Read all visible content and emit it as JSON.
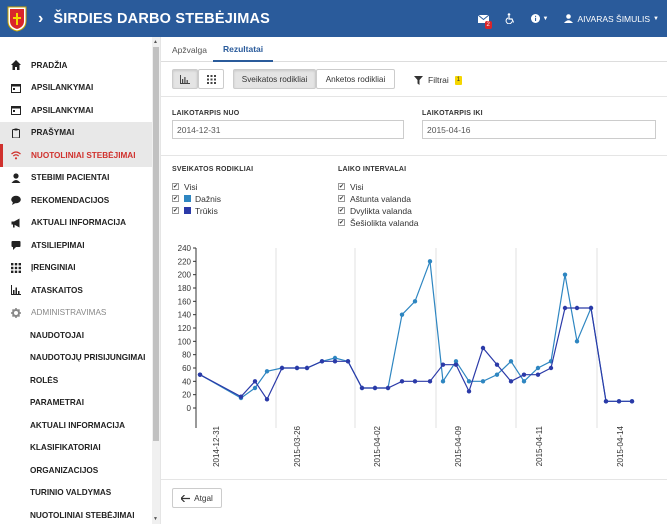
{
  "header": {
    "title": "ŠIRDIES DARBO STEBĖJIMAS",
    "mail_badge": "2",
    "user_name": "AIVARAS ŠIMULIS"
  },
  "sidebar": {
    "items": [
      {
        "label": "PRADŽIA",
        "icon": "home-icon"
      },
      {
        "label": "APSILANKYMAI",
        "icon": "calendar-icon"
      },
      {
        "label": "APSILANKYMAI",
        "icon": "calendar-icon"
      },
      {
        "label": "PRAŠYMAI",
        "icon": "clipboard-icon"
      },
      {
        "label": "NUOTOLINIAI STEBĖJIMAI",
        "icon": "wifi-icon"
      },
      {
        "label": "STEBIMI PACIENTAI",
        "icon": "user-icon"
      },
      {
        "label": "REKOMENDACIJOS",
        "icon": "comment-icon"
      },
      {
        "label": "AKTUALI INFORMACIJA",
        "icon": "bullhorn-icon"
      },
      {
        "label": "ATSILIEPIMAI",
        "icon": "feedback-icon"
      },
      {
        "label": "ĮRENGINIAI",
        "icon": "grid-icon"
      },
      {
        "label": "ATASKAITOS",
        "icon": "bar-chart-icon"
      },
      {
        "label": "ADMINISTRAVIMAS",
        "icon": "gear-icon"
      },
      {
        "label": "NAUDOTOJAI"
      },
      {
        "label": "NAUDOTOJŲ PRISIJUNGIMAI"
      },
      {
        "label": "ROLĖS"
      },
      {
        "label": "PARAMETRAI"
      },
      {
        "label": "AKTUALI INFORMACIJA"
      },
      {
        "label": "KLASIFIKATORIAI"
      },
      {
        "label": "ORGANIZACIJOS"
      },
      {
        "label": "TURINIO VALDYMAS"
      },
      {
        "label": "NUOTOLINIAI STEBĖJIMAI"
      }
    ]
  },
  "tabs": [
    "Apžvalga",
    "Rezultatai"
  ],
  "toolbar": {
    "health_btn": "Sveikatos rodikliai",
    "survey_btn": "Anketos rodikliai",
    "filters_label": "Filtrai",
    "filters_badge": "1"
  },
  "filters": {
    "from_label": "LAIKOTARPIS NUO",
    "from_value": "2014-12-31",
    "to_label": "LAIKOTARPIS IKI",
    "to_value": "2015-04-16",
    "health_title": "SVEIKATOS RODIKLIAI",
    "health_opts": [
      "Visi",
      "Dažnis",
      "Trūkis"
    ],
    "interval_title": "LAIKO INTERVALAI",
    "interval_opts": [
      "Visi",
      "Aštunta valanda",
      "Dvylikta valanda",
      "Šešiolikta valanda"
    ]
  },
  "colors": {
    "brand": "#2a5b9b",
    "active_nav": "#d0312d",
    "series_freq": "#2e86c1",
    "series_rhythm": "#2b3aa8",
    "filter_badge": "#f5d600"
  },
  "chart_data": {
    "type": "line",
    "x": [
      "2014-12-31",
      "2015-03-24",
      "2015-03-25",
      "2015-03-25b",
      "2015-03-26",
      "2015-03-27",
      "2015-03-28",
      "2015-03-29",
      "2015-03-30",
      "2015-03-31",
      "2015-04-01",
      "2015-04-02",
      "2015-04-03",
      "2015-04-04",
      "2015-04-05",
      "2015-04-06",
      "2015-04-07",
      "2015-04-08",
      "2015-04-09",
      "2015-04-10a",
      "2015-04-10b",
      "2015-04-10c",
      "2015-04-11a",
      "2015-04-11b",
      "2015-04-11c",
      "2015-04-12",
      "2015-04-13a",
      "2015-04-13b",
      "2015-04-14a",
      "2015-04-14b",
      "2015-04-15"
    ],
    "x_ticks": [
      "2014-12-31",
      "2015-03-26",
      "2015-04-02",
      "2015-04-09",
      "2015-04-11",
      "2015-04-14"
    ],
    "ylim": [
      0,
      240
    ],
    "yticks": [
      0,
      20,
      40,
      60,
      80,
      100,
      120,
      140,
      160,
      180,
      200,
      220,
      240
    ],
    "series": [
      {
        "name": "Dažnis",
        "values": [
          50,
          15,
          30,
          55,
          60,
          60,
          60,
          70,
          75,
          70,
          30,
          30,
          30,
          140,
          160,
          220,
          40,
          70,
          40,
          40,
          50,
          70,
          40,
          60,
          70,
          200,
          100,
          150,
          10,
          10,
          10
        ]
      },
      {
        "name": "Trūkis",
        "values": [
          50,
          17,
          40,
          13,
          60,
          60,
          60,
          70,
          70,
          70,
          30,
          30,
          30,
          40,
          40,
          40,
          65,
          65,
          25,
          90,
          65,
          40,
          50,
          50,
          60,
          150,
          150,
          150,
          10,
          10,
          10
        ]
      }
    ]
  },
  "footer": {
    "back_label": "Atgal"
  }
}
